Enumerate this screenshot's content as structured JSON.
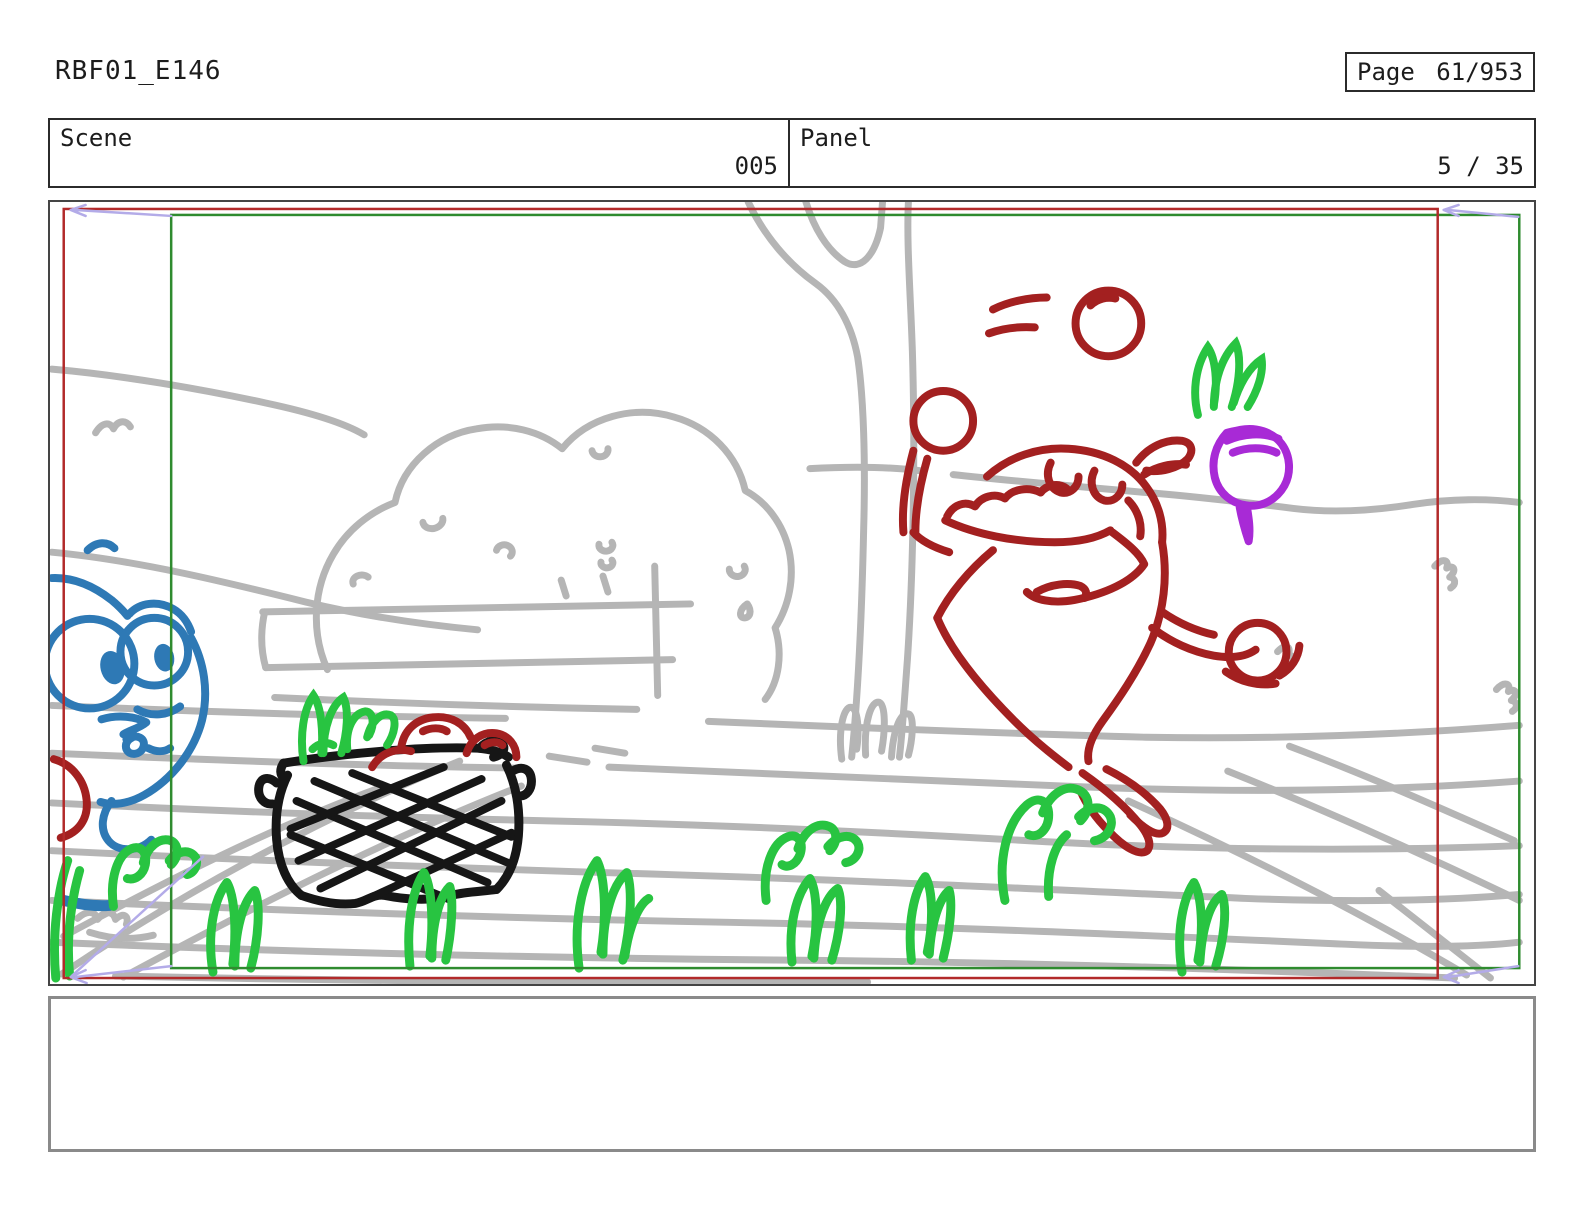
{
  "header": {
    "title": "RBF01_E146",
    "page_label": "Page",
    "page_value": "61/953"
  },
  "info": {
    "scene_label": "Scene",
    "scene_value": "005",
    "panel_label": "Panel",
    "panel_value": "5 / 35"
  },
  "caption": {
    "text": ""
  },
  "colors": {
    "sketch_gray": "#b5b5b5",
    "character_blue": "#2e79b5",
    "character_red": "#a32020",
    "vegetable_green": "#28c441",
    "turnip_purple": "#a82ad6",
    "basket_black": "#161616",
    "camera_frame_green": "#2f8b2f",
    "camera_frame_red": "#b22a2a",
    "camera_arrow_lavender": "#b3abe8"
  }
}
